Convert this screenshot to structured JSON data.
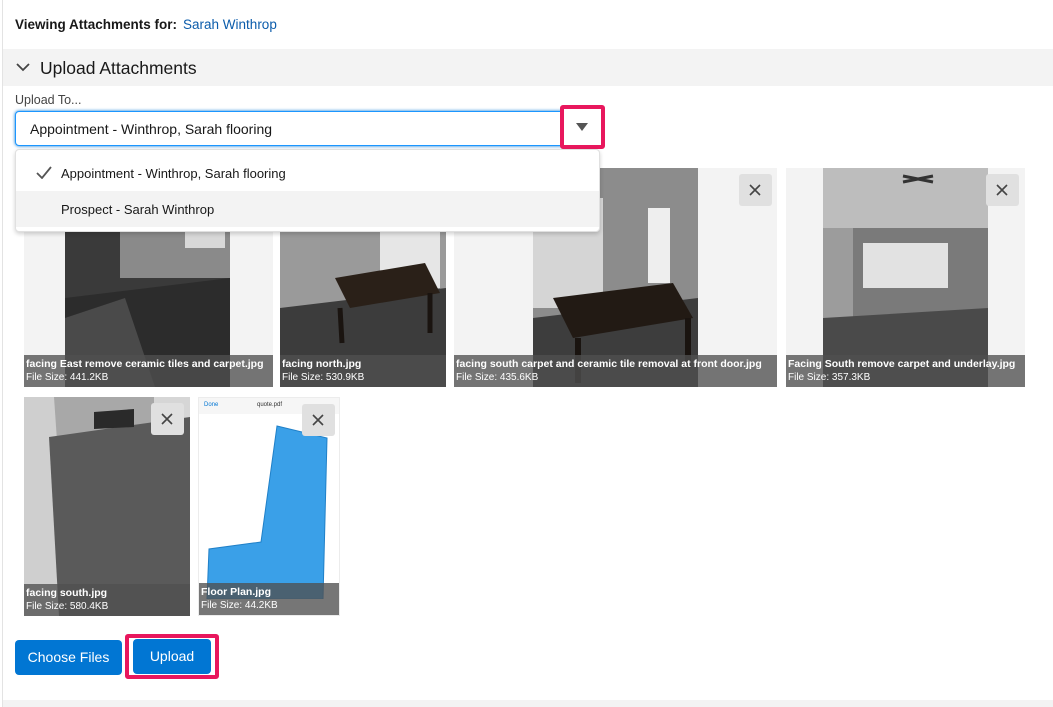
{
  "header": {
    "viewing_label": "Viewing Attachments for:",
    "viewing_name": "Sarah Winthrop"
  },
  "section": {
    "title": "Upload Attachments",
    "icon": "chevron-down-icon"
  },
  "upload_to": {
    "label": "Upload To...",
    "selected": "Appointment - Winthrop, Sarah flooring",
    "options": [
      {
        "label": "Appointment - Winthrop, Sarah flooring",
        "selected": true
      },
      {
        "label": "Prospect - Sarah Winthrop",
        "selected": false
      }
    ]
  },
  "attachments": [
    {
      "name": "facing East remove ceramic tiles and carpet.jpg",
      "size": "File Size: 441.2KB"
    },
    {
      "name": "facing north.jpg",
      "size": "File Size: 530.9KB"
    },
    {
      "name": "facing south carpet and ceramic tile removal at front door.jpg",
      "size": "File Size: 435.6KB"
    },
    {
      "name": "Facing South remove carpet and underlay.jpg",
      "size": "File Size: 357.3KB"
    },
    {
      "name": "facing south.jpg",
      "size": "File Size: 580.4KB"
    },
    {
      "name": "Floor Plan.jpg",
      "size": "File Size: 44.2KB"
    }
  ],
  "pdf_preview": {
    "done": "Done",
    "title": "quote.pdf"
  },
  "buttons": {
    "choose_files": "Choose Files",
    "upload": "Upload"
  },
  "colors": {
    "brand": "#0176d3",
    "link": "#0b5cab",
    "highlight": "#e8175d"
  }
}
